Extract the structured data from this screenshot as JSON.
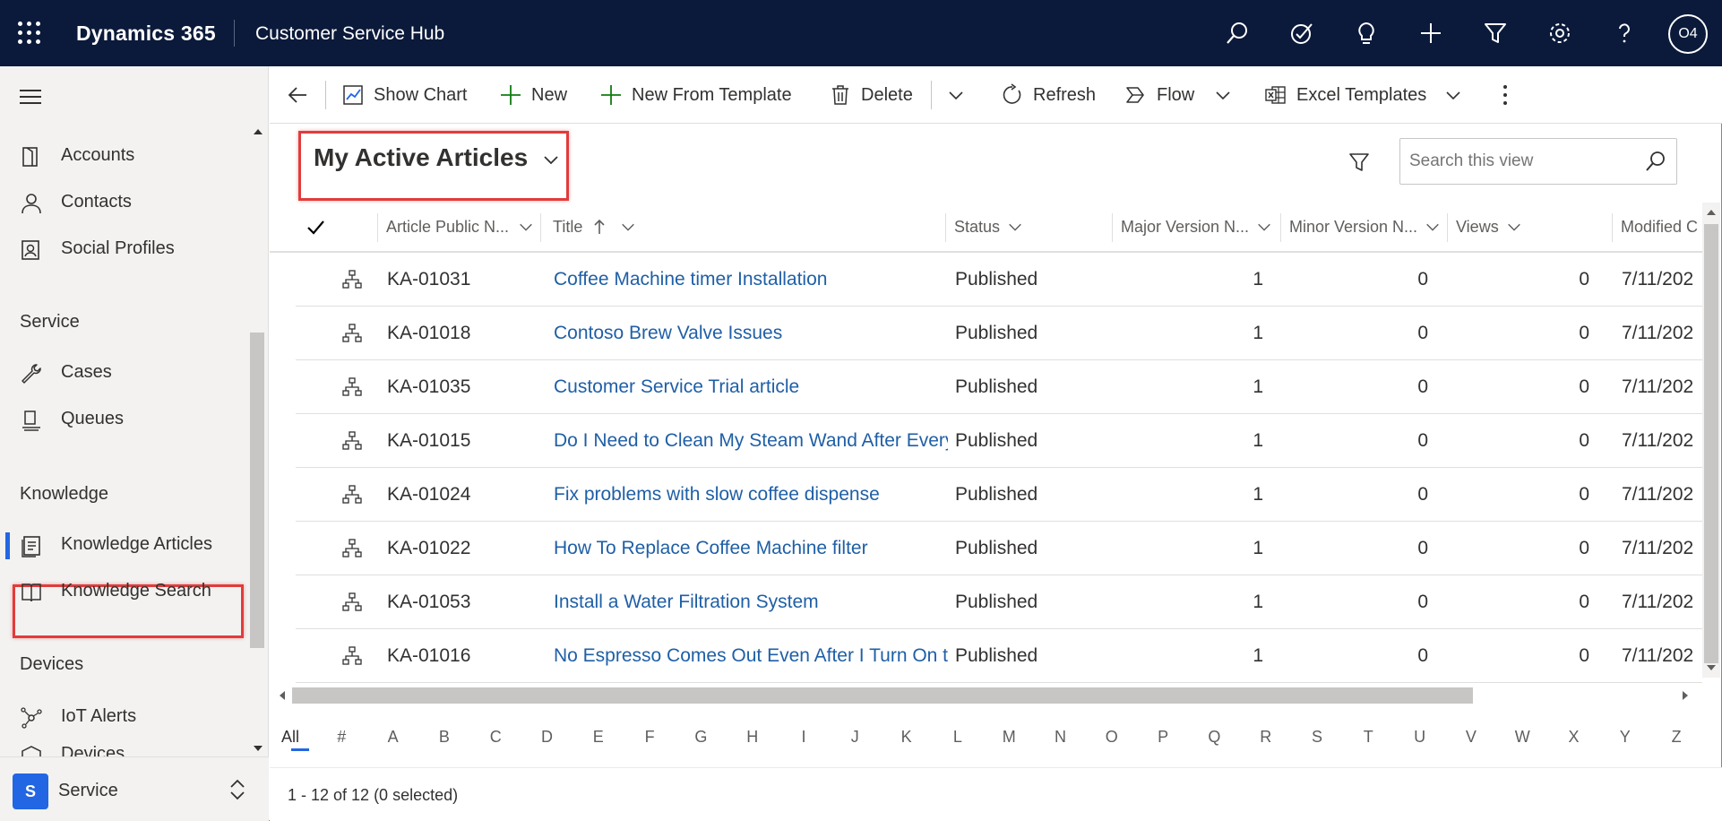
{
  "header": {
    "app_name": "Dynamics 365",
    "hub_name": "Customer Service Hub",
    "avatar_initials": "O4",
    "background_color": "#0b1a3a"
  },
  "sidebar": {
    "items_top": [
      {
        "label": "Accounts",
        "icon": "accounts-icon"
      },
      {
        "label": "Contacts",
        "icon": "person-icon"
      },
      {
        "label": "Social Profiles",
        "icon": "social-profile-icon"
      }
    ],
    "section_service": "Service",
    "items_service": [
      {
        "label": "Cases",
        "icon": "wrench-icon"
      },
      {
        "label": "Queues",
        "icon": "queue-icon"
      }
    ],
    "section_knowledge": "Knowledge",
    "items_knowledge": [
      {
        "label": "Knowledge Articles",
        "icon": "article-icon",
        "selected": true
      },
      {
        "label": "Knowledge Search",
        "icon": "book-icon"
      }
    ],
    "section_devices": "Devices",
    "items_devices": [
      {
        "label": "IoT Alerts",
        "icon": "iot-icon"
      },
      {
        "label": "Devices",
        "icon": "device-icon"
      }
    ],
    "area": {
      "badge": "S",
      "name": "Service"
    }
  },
  "commands": {
    "show_chart": "Show Chart",
    "new": "New",
    "new_from_template": "New From Template",
    "delete": "Delete",
    "refresh": "Refresh",
    "flow": "Flow",
    "excel_templates": "Excel Templates"
  },
  "view": {
    "title": "My Active Articles",
    "search_placeholder": "Search this view"
  },
  "grid": {
    "columns": [
      "Article Public N...",
      "Title",
      "Status",
      "Major Version N...",
      "Minor Version N...",
      "Views",
      "Modified C"
    ],
    "rows": [
      {
        "id": "KA-01031",
        "title": "Coffee Machine timer Installation",
        "status": "Published",
        "major": "1",
        "minor": "0",
        "views": "0",
        "modified": "7/11/202"
      },
      {
        "id": "KA-01018",
        "title": "Contoso Brew Valve Issues",
        "status": "Published",
        "major": "1",
        "minor": "0",
        "views": "0",
        "modified": "7/11/202"
      },
      {
        "id": "KA-01035",
        "title": "Customer Service Trial article",
        "status": "Published",
        "major": "1",
        "minor": "0",
        "views": "0",
        "modified": "7/11/202"
      },
      {
        "id": "KA-01015",
        "title": "Do I Need to Clean My Steam Wand After Every",
        "status": "Published",
        "major": "1",
        "minor": "0",
        "views": "0",
        "modified": "7/11/202"
      },
      {
        "id": "KA-01024",
        "title": "Fix problems with slow coffee dispense",
        "status": "Published",
        "major": "1",
        "minor": "0",
        "views": "0",
        "modified": "7/11/202"
      },
      {
        "id": "KA-01022",
        "title": "How To Replace Coffee Machine filter",
        "status": "Published",
        "major": "1",
        "minor": "0",
        "views": "0",
        "modified": "7/11/202"
      },
      {
        "id": "KA-01053",
        "title": "Install a Water Filtration System",
        "status": "Published",
        "major": "1",
        "minor": "0",
        "views": "0",
        "modified": "7/11/202"
      },
      {
        "id": "KA-01016",
        "title": "No Espresso Comes Out Even After I Turn On th",
        "status": "Published",
        "major": "1",
        "minor": "0",
        "views": "0",
        "modified": "7/11/202"
      }
    ]
  },
  "jumpbar": [
    "All",
    "#",
    "A",
    "B",
    "C",
    "D",
    "E",
    "F",
    "G",
    "H",
    "I",
    "J",
    "K",
    "L",
    "M",
    "N",
    "O",
    "P",
    "Q",
    "R",
    "S",
    "T",
    "U",
    "V",
    "W",
    "X",
    "Y",
    "Z"
  ],
  "footer": {
    "status": "1 - 12 of 12 (0 selected)"
  },
  "colors": {
    "accent": "#2266e3",
    "link": "#1f5fa6",
    "highlight_box": "#e23b3b"
  }
}
